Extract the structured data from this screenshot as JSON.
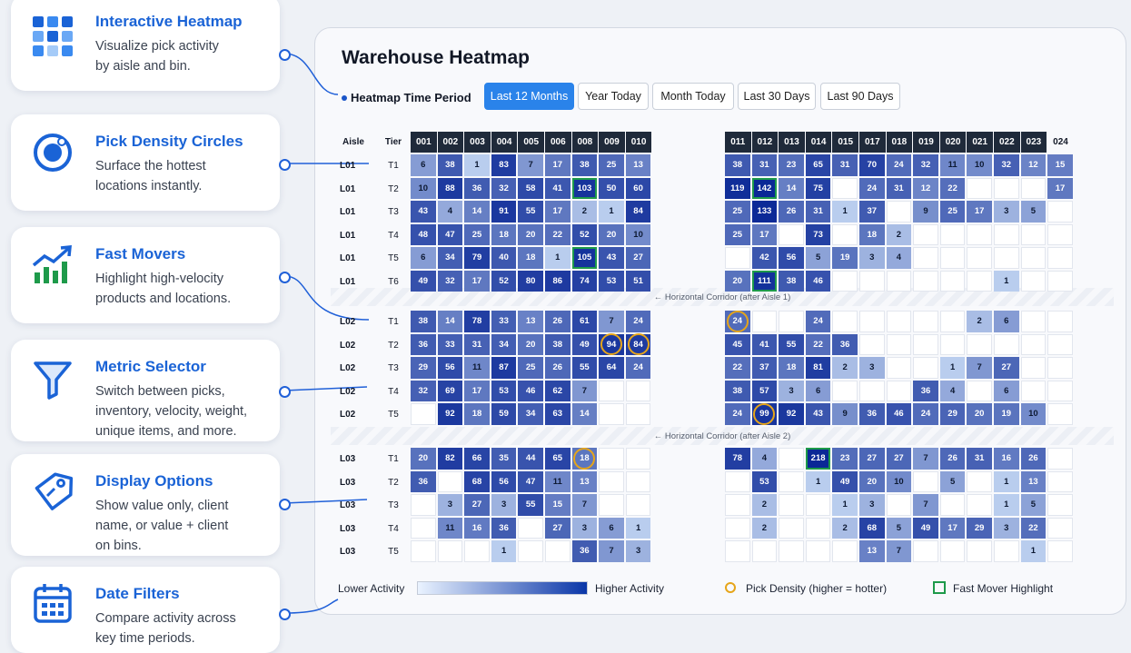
{
  "features": [
    {
      "title": "Interactive Heatmap",
      "desc_lines": [
        "Visualize pick activity",
        "by aisle and bin."
      ],
      "icon": "grid-icon"
    },
    {
      "title": "Pick Density Circles",
      "desc_lines": [
        "Surface the hottest",
        "locations instantly."
      ],
      "icon": "target-icon"
    },
    {
      "title": "Fast Movers",
      "desc_lines": [
        "Highlight high-velocity",
        "products and locations."
      ],
      "icon": "trend-chart-icon"
    },
    {
      "title": "Metric Selector",
      "desc_lines": [
        "Switch between picks,",
        "inventory, velocity, weight,",
        "unique items, and more."
      ],
      "icon": "funnel-icon"
    },
    {
      "title": "Display Options",
      "desc_lines": [
        "Show value only, client",
        "name, or value + client",
        "on bins."
      ],
      "icon": "tag-icon"
    },
    {
      "title": "Date Filters",
      "desc_lines": [
        "Compare activity across",
        "key time periods."
      ],
      "icon": "calendar-icon"
    }
  ],
  "panel": {
    "title": "Warehouse Heatmap",
    "period_label": "Heatmap Time Period",
    "periods": [
      "Last 12 Months",
      "Year Today",
      "Month Today",
      "Last 30 Days",
      "Last 90 Days"
    ],
    "active_period": "Last 12 Months"
  },
  "grid": {
    "aisle_header": "Aisle",
    "tier_header": "Tier",
    "columns_left": [
      "001",
      "002",
      "003",
      "004",
      "005",
      "006",
      "008",
      "009",
      "010"
    ],
    "columns_right": [
      "011",
      "012",
      "013",
      "014",
      "015",
      "017",
      "018",
      "019",
      "020",
      "021",
      "022",
      "023",
      "024"
    ],
    "corridors": [
      "← Horizontal Corridor (after Aisle 1)",
      "← Horizontal Corridor (after Aisle 2)"
    ],
    "sections": [
      {
        "rows": [
          {
            "aisle": "L01",
            "tier": "T1",
            "left": [
              6,
              38,
              1,
              83,
              7,
              17,
              38,
              25,
              13
            ],
            "right": [
              38,
              31,
              23,
              65,
              31,
              70,
              24,
              32,
              11,
              10,
              32,
              12,
              15
            ]
          },
          {
            "aisle": "L01",
            "tier": "T2",
            "left": [
              10,
              88,
              36,
              32,
              58,
              41,
              103,
              50,
              60
            ],
            "right": [
              119,
              142,
              14,
              75,
              null,
              24,
              31,
              12,
              22,
              null,
              null,
              null,
              17
            ]
          },
          {
            "aisle": "L01",
            "tier": "T3",
            "left": [
              43,
              4,
              14,
              91,
              55,
              17,
              2,
              1,
              84
            ],
            "right": [
              25,
              133,
              26,
              31,
              1,
              37,
              null,
              9,
              25,
              17,
              3,
              5,
              null
            ]
          },
          {
            "aisle": "L01",
            "tier": "T4",
            "left": [
              48,
              47,
              25,
              18,
              20,
              22,
              52,
              20,
              10
            ],
            "right": [
              25,
              17,
              null,
              73,
              null,
              18,
              2,
              null,
              null,
              null,
              null,
              null,
              null
            ]
          },
          {
            "aisle": "L01",
            "tier": "T5",
            "left": [
              6,
              34,
              79,
              40,
              18,
              1,
              105,
              43,
              27
            ],
            "right": [
              null,
              42,
              56,
              5,
              19,
              3,
              4,
              null,
              null,
              null,
              null,
              null,
              null
            ]
          },
          {
            "aisle": "L01",
            "tier": "T6",
            "left": [
              49,
              32,
              17,
              52,
              80,
              86,
              74,
              53,
              51
            ],
            "right": [
              20,
              111,
              38,
              46,
              null,
              null,
              null,
              null,
              null,
              null,
              1,
              null,
              null
            ]
          }
        ]
      },
      {
        "rows": [
          {
            "aisle": "L02",
            "tier": "T1",
            "left": [
              38,
              14,
              78,
              33,
              13,
              26,
              61,
              7,
              24
            ],
            "right": [
              24,
              null,
              null,
              24,
              null,
              null,
              null,
              null,
              null,
              2,
              6,
              null,
              null
            ]
          },
          {
            "aisle": "L02",
            "tier": "T2",
            "left": [
              36,
              33,
              31,
              34,
              20,
              38,
              49,
              94,
              84
            ],
            "right": [
              45,
              41,
              55,
              22,
              36,
              null,
              null,
              null,
              null,
              null,
              null,
              null,
              null
            ]
          },
          {
            "aisle": "L02",
            "tier": "T3",
            "left": [
              29,
              56,
              11,
              87,
              25,
              26,
              55,
              64,
              24
            ],
            "right": [
              22,
              37,
              18,
              81,
              2,
              3,
              null,
              null,
              1,
              7,
              27,
              null,
              null
            ]
          },
          {
            "aisle": "L02",
            "tier": "T4",
            "left": [
              32,
              69,
              17,
              53,
              46,
              62,
              7,
              null,
              null
            ],
            "right": [
              38,
              57,
              3,
              6,
              null,
              null,
              null,
              36,
              4,
              null,
              6,
              null,
              null
            ]
          },
          {
            "aisle": "L02",
            "tier": "T5",
            "left": [
              null,
              92,
              18,
              59,
              34,
              63,
              14,
              null,
              null
            ],
            "right": [
              24,
              99,
              92,
              43,
              9,
              36,
              46,
              24,
              29,
              20,
              19,
              10,
              null
            ]
          }
        ]
      },
      {
        "rows": [
          {
            "aisle": "L03",
            "tier": "T1",
            "left": [
              20,
              82,
              66,
              35,
              44,
              65,
              18,
              null,
              null
            ],
            "right": [
              78,
              4,
              null,
              218,
              23,
              27,
              27,
              7,
              26,
              31,
              16,
              26,
              null
            ]
          },
          {
            "aisle": "L03",
            "tier": "T2",
            "left": [
              36,
              null,
              68,
              56,
              47,
              11,
              13,
              null,
              null
            ],
            "right": [
              null,
              53,
              null,
              1,
              49,
              20,
              10,
              null,
              5,
              null,
              1,
              13,
              null
            ]
          },
          {
            "aisle": "L03",
            "tier": "T3",
            "left": [
              null,
              3,
              27,
              3,
              55,
              15,
              7,
              null,
              null
            ],
            "right": [
              null,
              2,
              null,
              null,
              1,
              3,
              null,
              7,
              null,
              null,
              1,
              5,
              null
            ]
          },
          {
            "aisle": "L03",
            "tier": "T4",
            "left": [
              null,
              11,
              16,
              36,
              null,
              27,
              3,
              6,
              1
            ],
            "right": [
              null,
              2,
              null,
              null,
              2,
              68,
              5,
              49,
              17,
              29,
              3,
              22,
              null
            ]
          },
          {
            "aisle": "L03",
            "tier": "T5",
            "left": [
              null,
              null,
              null,
              1,
              null,
              null,
              36,
              7,
              3
            ],
            "right": [
              null,
              null,
              null,
              null,
              null,
              13,
              7,
              null,
              null,
              null,
              null,
              1,
              null
            ]
          }
        ]
      }
    ],
    "density_circles": [
      "L02-T1-R0",
      "L02-T2-L7",
      "L02-T2-L8",
      "L02-T5-R1",
      "L03-T1-L6"
    ],
    "fast_movers": [
      "L01-T2-L6",
      "L01-T5-L6",
      "L01-T2-R1",
      "L01-T6-R1",
      "L03-T1-R3"
    ]
  },
  "legend": {
    "lower": "Lower Activity",
    "higher": "Higher Activity",
    "density": "Pick Density (higher = hotter)",
    "fast_mover": "Fast Mover Highlight"
  },
  "colors": {
    "accent": "#1a63d6",
    "active_tab": "#2a83ea",
    "header_dark": "#1f2a3a",
    "density_ring": "#e6a51a",
    "fast_mover": "#1e9a4a"
  }
}
